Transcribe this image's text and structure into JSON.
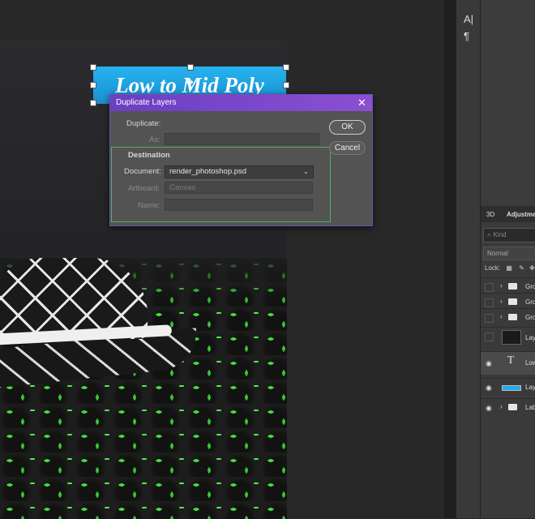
{
  "canvas": {
    "title_layer_text": "Low to Mid Poly"
  },
  "tools": {
    "char_label": "A|",
    "para_label": "¶"
  },
  "layers_panel": {
    "tabs": [
      "3D",
      "Adjustme"
    ],
    "search_placeholder": "Kind",
    "blend_mode": "Normal",
    "lock_label": "Lock:",
    "layers": [
      {
        "name": "Gro",
        "type": "group",
        "visible": false
      },
      {
        "name": "Gro",
        "type": "group",
        "visible": false
      },
      {
        "name": "Gro",
        "type": "group",
        "visible": false
      },
      {
        "name": "Lay",
        "type": "image",
        "visible": false
      },
      {
        "name": "Low",
        "type": "text",
        "visible": true
      },
      {
        "name": "Lay",
        "type": "shape",
        "visible": true
      },
      {
        "name": "Lab",
        "type": "group",
        "visible": true
      }
    ]
  },
  "dialog": {
    "title": "Duplicate Layers",
    "close_glyph": "✕",
    "duplicate_label": "Duplicate:",
    "as_label": "As:",
    "as_value": "",
    "destination_label": "Destination",
    "document_label": "Document:",
    "document_value": "render_photoshop.psd",
    "artboard_label": "Artboard:",
    "artboard_value": "Canvas",
    "name_label": "Name:",
    "name_value": "",
    "ok_label": "OK",
    "cancel_label": "Cancel"
  },
  "colors": {
    "accent_purple": "#7a47c9",
    "title_layer_blue": "#22a6e6",
    "destination_border": "#4fae66"
  }
}
